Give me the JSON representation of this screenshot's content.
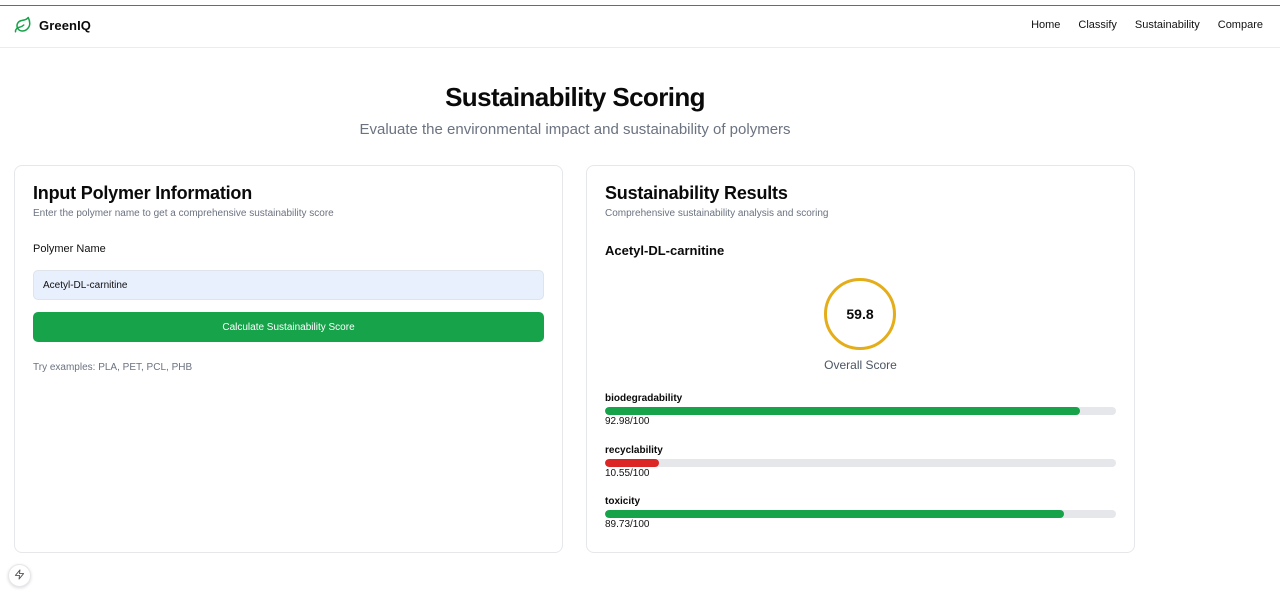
{
  "brand": {
    "name": "GreenIQ",
    "icon": "leaf-icon",
    "accent": "#16a34a"
  },
  "nav": {
    "items": [
      {
        "label": "Home"
      },
      {
        "label": "Classify"
      },
      {
        "label": "Sustainability"
      },
      {
        "label": "Compare"
      }
    ]
  },
  "page": {
    "title": "Sustainability Scoring",
    "subtitle": "Evaluate the environmental impact and sustainability of polymers"
  },
  "input_card": {
    "title": "Input Polymer Information",
    "description": "Enter the polymer name to get a comprehensive sustainability score",
    "field_label": "Polymer Name",
    "field_value": "Acetyl-DL-carnitine",
    "button_label": "Calculate Sustainability Score",
    "examples": "Try examples: PLA, PET, PCL, PHB"
  },
  "results_card": {
    "title": "Sustainability Results",
    "description": "Comprehensive sustainability analysis and scoring",
    "polymer_name": "Acetyl-DL-carnitine",
    "overall_score": "59.8",
    "overall_label": "Overall Score",
    "score_ring_color": "#e4ad1a",
    "metrics": [
      {
        "name": "biodegradability",
        "value_text": "92.98/100",
        "value": 92.98,
        "color": "#16a34a"
      },
      {
        "name": "recyclability",
        "value_text": "10.55/100",
        "value": 10.55,
        "color": "#dc2626"
      },
      {
        "name": "toxicity",
        "value_text": "89.73/100",
        "value": 89.73,
        "color": "#16a34a"
      }
    ]
  },
  "dev_indicator": {
    "icon": "lightning-bolt-icon"
  }
}
